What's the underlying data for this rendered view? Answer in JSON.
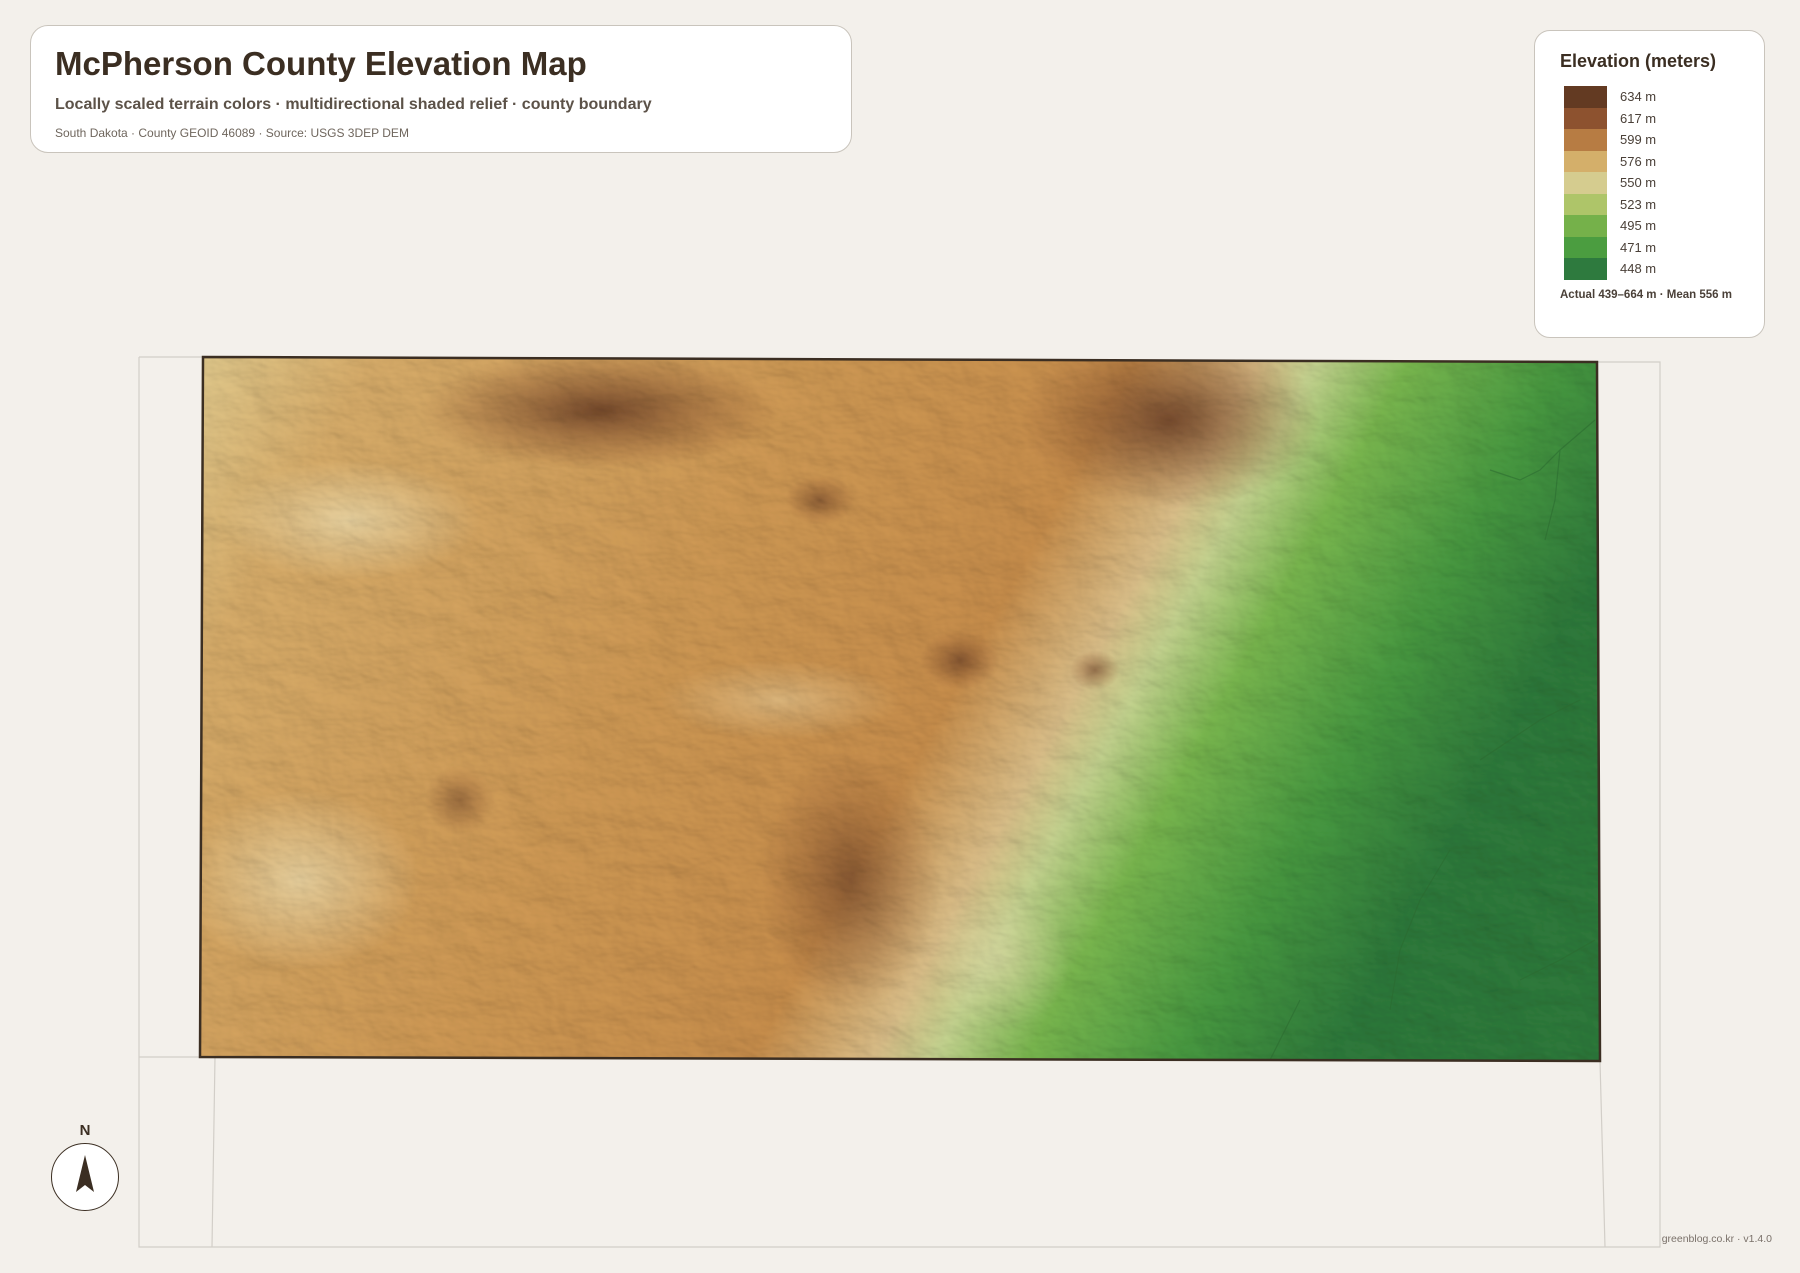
{
  "header": {
    "title": "McPherson County Elevation Map",
    "subtitle": "Locally scaled terrain colors · multidirectional shaded relief · county boundary",
    "source": "South Dakota · County GEOID 46089 · Source: USGS 3DEP DEM"
  },
  "legend": {
    "title": "Elevation (meters)",
    "items": [
      {
        "label": "634 m",
        "color": "#633a22"
      },
      {
        "label": "617 m",
        "color": "#8d522f"
      },
      {
        "label": "599 m",
        "color": "#b77c43"
      },
      {
        "label": "576 m",
        "color": "#d4af6a"
      },
      {
        "label": "550 m",
        "color": "#d5cc8f"
      },
      {
        "label": "523 m",
        "color": "#aec569"
      },
      {
        "label": "495 m",
        "color": "#75b14a"
      },
      {
        "label": "471 m",
        "color": "#4b9d40"
      },
      {
        "label": "448 m",
        "color": "#2e7a3e"
      }
    ],
    "note": "Actual 439–664 m · Mean 556 m"
  },
  "compass": {
    "label": "N",
    "icon": "north-arrow-icon"
  },
  "footer": {
    "credit": "greenblog.co.kr · v1.4.0"
  }
}
